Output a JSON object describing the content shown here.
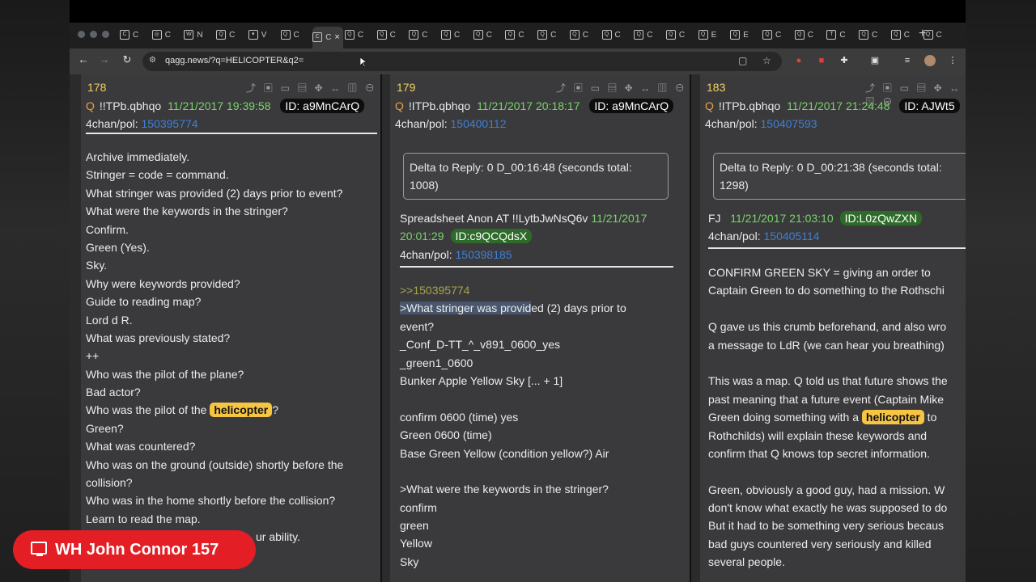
{
  "browser": {
    "url": "qagg.news/?q=HELICOPTER&q2=",
    "tabs": [
      {
        "glyph": "C",
        "label": "C"
      },
      {
        "glyph": "◎",
        "label": "C"
      },
      {
        "glyph": "W",
        "label": "N"
      },
      {
        "glyph": "Q",
        "label": "C"
      },
      {
        "glyph": "▾",
        "label": "V"
      },
      {
        "glyph": "Q",
        "label": "C"
      },
      {
        "glyph": "C",
        "label": "C"
      },
      {
        "glyph": "Q",
        "label": "C"
      },
      {
        "glyph": "Q",
        "label": "C"
      },
      {
        "glyph": "Q",
        "label": "C"
      },
      {
        "glyph": "Q",
        "label": "C"
      },
      {
        "glyph": "Q",
        "label": "C"
      },
      {
        "glyph": "Q",
        "label": "C"
      },
      {
        "glyph": "Q",
        "label": "C"
      },
      {
        "glyph": "Q",
        "label": "C"
      },
      {
        "glyph": "Q",
        "label": "C"
      },
      {
        "glyph": "Q",
        "label": "C"
      },
      {
        "glyph": "Q",
        "label": "C"
      },
      {
        "glyph": "Q",
        "label": "E"
      },
      {
        "glyph": "Q",
        "label": "E"
      },
      {
        "glyph": "Q",
        "label": "C"
      },
      {
        "glyph": "Q",
        "label": "C"
      },
      {
        "glyph": "T",
        "label": "C"
      },
      {
        "glyph": "Q",
        "label": "C"
      },
      {
        "glyph": "Q",
        "label": "C"
      },
      {
        "glyph": "Q",
        "label": "C"
      }
    ],
    "active_tab_close": "×",
    "new_tab": "+"
  },
  "columns": [
    {
      "post_num": "178",
      "q": "Q",
      "trip": "!!TPb.qbhqo",
      "date": "11/21/2017 19:39:58",
      "id": "ID: a9MnCArQ",
      "board": "4chan/pol:",
      "post_link": "150395774",
      "lines": [
        "Archive immediately.",
        "Stringer = code = command.",
        "What stringer was provided (2) days prior to event?",
        "What were the keywords in the stringer?",
        "Confirm.",
        "Green (Yes).",
        "Sky.",
        "Why were keywords provided?",
        "Guide to reading map?",
        "Lord d R.",
        "What was previously stated?",
        "++",
        "Who was the pilot of the plane?",
        "Bad actor?",
        "__HELI1__",
        "Green?",
        "What was countered?",
        "Who was on the ground (outside) shortly before the",
        "collision?",
        "Who was in the home shortly before the collision?",
        "Learn to read the map.",
        "ur ability."
      ],
      "heli_line_prefix": "Who was the pilot of the ",
      "heli_word": "helicopter",
      "heli_line_suffix": "?"
    },
    {
      "post_num": "179",
      "q": "Q",
      "trip": "!ITPb.qbhqo",
      "date": "11/21/2017 20:18:17",
      "id": "ID: a9MnCArQ",
      "board": "4chan/pol:",
      "post_link": "150400112",
      "delta_1": "Delta to Reply: 0 D_00:16:48  (seconds total:",
      "delta_2": "1008)",
      "reply_author": "Spreadsheet Anon AT  !!LytbJwNsQ6v",
      "reply_date_1": "11/21/2017",
      "reply_date_2": "20:01:29",
      "reply_id": "ID:c9QCQdsX",
      "reply_board": "4chan/pol:",
      "reply_link": "150398185",
      "quote_link": ">>150395774",
      "sel_text": ">What stringer was provid",
      "sel_rest": "ed (2) days prior to",
      "lines": [
        "event?",
        "_Conf_D-TT_^_v891_0600_yes",
        "_green1_0600",
        "Bunker Apple Yellow Sky [... + 1]",
        "",
        "confirm 0600 (time) yes",
        "Green 0600 (time)",
        "Base Green Yellow (condition yellow?) Air",
        "",
        ">What were the keywords in the stringer?",
        "confirm",
        "green",
        "Yellow",
        "Sky"
      ]
    },
    {
      "post_num": "183",
      "q": "Q",
      "trip": "!ITPb.qbhqo",
      "date": "11/21/2017 21:24:48",
      "id": "ID: AJWt5",
      "board": "4chan/pol:",
      "post_link": "150407593",
      "delta_1": "Delta to Reply: 0 D_00:21:38  (seconds total:",
      "delta_2": "1298)",
      "reply_author": "FJ",
      "reply_date": "11/21/2017 21:03:10",
      "reply_id": "ID:L0zQwZXN",
      "reply_board": "4chan/pol:",
      "reply_link": "150405114",
      "lines": [
        "CONFIRM GREEN SKY = giving an order to",
        "Captain Green to do something to the Rothschi",
        "",
        "Q gave us this crumb beforehand, and also wro",
        "a message to LdR (we can hear you breathing)",
        "",
        "This was a map. Q told us that future shows the",
        "past meaning that a future event (Captain Mike",
        "__HELI3__",
        "Rothchilds) will explain these keywords and",
        "confirm that Q knows top secret information.",
        "",
        "Green, obviously a good guy, had a mission. W",
        "don't know what exactly he was supposed to do",
        "But it had to be something very serious becaus",
        "bad guys countered very seriously and killed",
        "several people."
      ],
      "heli_line_prefix": "Green doing something with a ",
      "heli_word": "helicopter",
      "heli_line_suffix": " to"
    }
  ],
  "overlay": {
    "channel": "WH John Connor 157"
  }
}
